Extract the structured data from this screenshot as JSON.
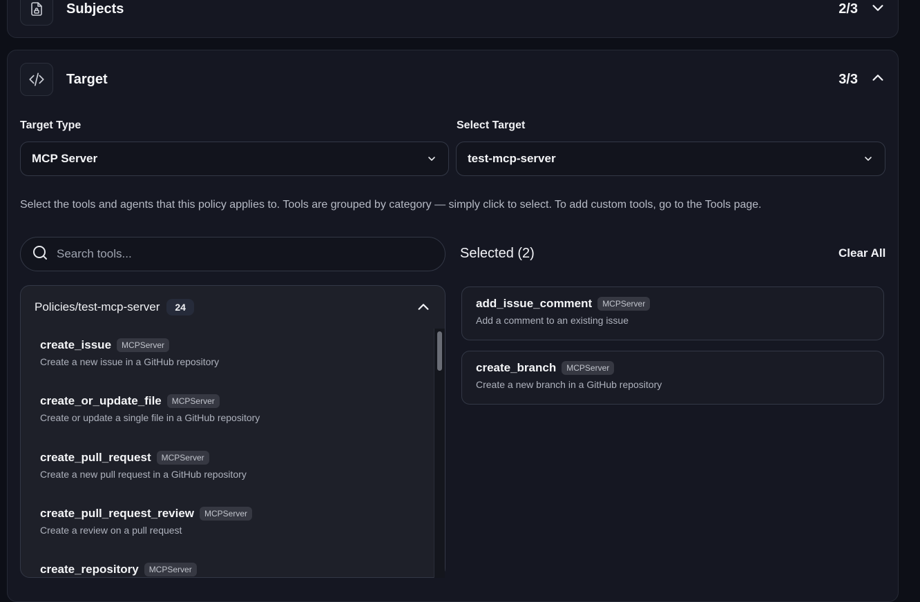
{
  "subjects": {
    "title": "Subjects",
    "count": "2/3",
    "icon": "file-lock-icon",
    "toggle_icon": "chevron-down-icon"
  },
  "target": {
    "title": "Target",
    "count": "3/3",
    "icon": "code-icon",
    "toggle_icon": "chevron-up-icon",
    "target_type_label": "Target Type",
    "target_type_value": "MCP Server",
    "select_target_label": "Select Target",
    "select_target_value": "test-mcp-server",
    "help_text": "Select the tools and agents that this policy applies to. Tools are grouped by category — simply click to select. To add custom tools, go to the Tools page.",
    "search_placeholder": "Search tools...",
    "selected_title": "Selected (2)",
    "clear_all": "Clear All",
    "group": {
      "name": "Policies/test-mcp-server",
      "count": "24",
      "tools": [
        {
          "name": "create_issue",
          "badge": "MCPServer",
          "desc": "Create a new issue in a GitHub repository"
        },
        {
          "name": "create_or_update_file",
          "badge": "MCPServer",
          "desc": "Create or update a single file in a GitHub repository"
        },
        {
          "name": "create_pull_request",
          "badge": "MCPServer",
          "desc": "Create a new pull request in a GitHub repository"
        },
        {
          "name": "create_pull_request_review",
          "badge": "MCPServer",
          "desc": "Create a review on a pull request"
        },
        {
          "name": "create_repository",
          "badge": "MCPServer",
          "desc": ""
        }
      ]
    },
    "selected": [
      {
        "name": "add_issue_comment",
        "badge": "MCPServer",
        "desc": "Add a comment to an existing issue"
      },
      {
        "name": "create_branch",
        "badge": "MCPServer",
        "desc": "Create a new branch in a GitHub repository"
      }
    ]
  },
  "colors": {
    "background": "#0d0f17",
    "card": "#151722",
    "border": "#333846",
    "badge": "#363842"
  }
}
